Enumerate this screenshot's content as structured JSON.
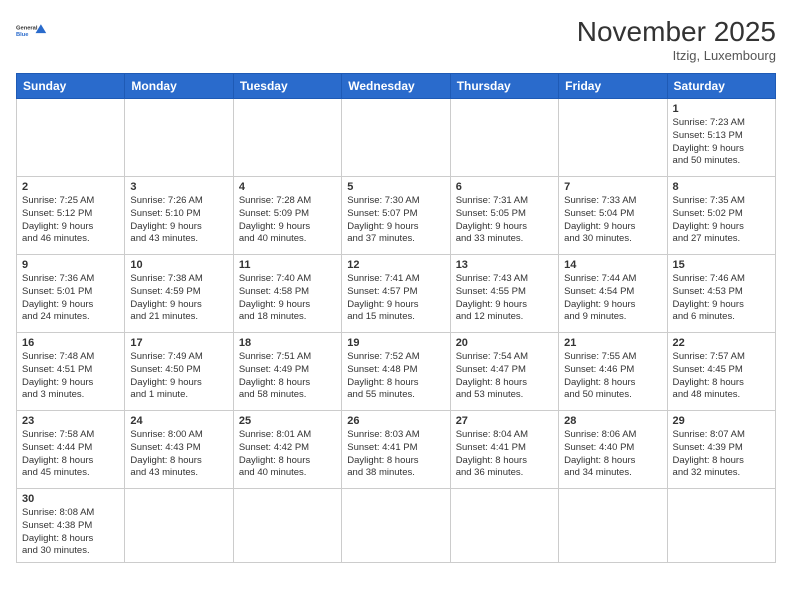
{
  "header": {
    "logo_general": "General",
    "logo_blue": "Blue",
    "month_title": "November 2025",
    "location": "Itzig, Luxembourg"
  },
  "weekdays": [
    "Sunday",
    "Monday",
    "Tuesday",
    "Wednesday",
    "Thursday",
    "Friday",
    "Saturday"
  ],
  "weeks": [
    [
      {
        "day": "",
        "info": ""
      },
      {
        "day": "",
        "info": ""
      },
      {
        "day": "",
        "info": ""
      },
      {
        "day": "",
        "info": ""
      },
      {
        "day": "",
        "info": ""
      },
      {
        "day": "",
        "info": ""
      },
      {
        "day": "1",
        "info": "Sunrise: 7:23 AM\nSunset: 5:13 PM\nDaylight: 9 hours\nand 50 minutes."
      }
    ],
    [
      {
        "day": "2",
        "info": "Sunrise: 7:25 AM\nSunset: 5:12 PM\nDaylight: 9 hours\nand 46 minutes."
      },
      {
        "day": "3",
        "info": "Sunrise: 7:26 AM\nSunset: 5:10 PM\nDaylight: 9 hours\nand 43 minutes."
      },
      {
        "day": "4",
        "info": "Sunrise: 7:28 AM\nSunset: 5:09 PM\nDaylight: 9 hours\nand 40 minutes."
      },
      {
        "day": "5",
        "info": "Sunrise: 7:30 AM\nSunset: 5:07 PM\nDaylight: 9 hours\nand 37 minutes."
      },
      {
        "day": "6",
        "info": "Sunrise: 7:31 AM\nSunset: 5:05 PM\nDaylight: 9 hours\nand 33 minutes."
      },
      {
        "day": "7",
        "info": "Sunrise: 7:33 AM\nSunset: 5:04 PM\nDaylight: 9 hours\nand 30 minutes."
      },
      {
        "day": "8",
        "info": "Sunrise: 7:35 AM\nSunset: 5:02 PM\nDaylight: 9 hours\nand 27 minutes."
      }
    ],
    [
      {
        "day": "9",
        "info": "Sunrise: 7:36 AM\nSunset: 5:01 PM\nDaylight: 9 hours\nand 24 minutes."
      },
      {
        "day": "10",
        "info": "Sunrise: 7:38 AM\nSunset: 4:59 PM\nDaylight: 9 hours\nand 21 minutes."
      },
      {
        "day": "11",
        "info": "Sunrise: 7:40 AM\nSunset: 4:58 PM\nDaylight: 9 hours\nand 18 minutes."
      },
      {
        "day": "12",
        "info": "Sunrise: 7:41 AM\nSunset: 4:57 PM\nDaylight: 9 hours\nand 15 minutes."
      },
      {
        "day": "13",
        "info": "Sunrise: 7:43 AM\nSunset: 4:55 PM\nDaylight: 9 hours\nand 12 minutes."
      },
      {
        "day": "14",
        "info": "Sunrise: 7:44 AM\nSunset: 4:54 PM\nDaylight: 9 hours\nand 9 minutes."
      },
      {
        "day": "15",
        "info": "Sunrise: 7:46 AM\nSunset: 4:53 PM\nDaylight: 9 hours\nand 6 minutes."
      }
    ],
    [
      {
        "day": "16",
        "info": "Sunrise: 7:48 AM\nSunset: 4:51 PM\nDaylight: 9 hours\nand 3 minutes."
      },
      {
        "day": "17",
        "info": "Sunrise: 7:49 AM\nSunset: 4:50 PM\nDaylight: 9 hours\nand 1 minute."
      },
      {
        "day": "18",
        "info": "Sunrise: 7:51 AM\nSunset: 4:49 PM\nDaylight: 8 hours\nand 58 minutes."
      },
      {
        "day": "19",
        "info": "Sunrise: 7:52 AM\nSunset: 4:48 PM\nDaylight: 8 hours\nand 55 minutes."
      },
      {
        "day": "20",
        "info": "Sunrise: 7:54 AM\nSunset: 4:47 PM\nDaylight: 8 hours\nand 53 minutes."
      },
      {
        "day": "21",
        "info": "Sunrise: 7:55 AM\nSunset: 4:46 PM\nDaylight: 8 hours\nand 50 minutes."
      },
      {
        "day": "22",
        "info": "Sunrise: 7:57 AM\nSunset: 4:45 PM\nDaylight: 8 hours\nand 48 minutes."
      }
    ],
    [
      {
        "day": "23",
        "info": "Sunrise: 7:58 AM\nSunset: 4:44 PM\nDaylight: 8 hours\nand 45 minutes."
      },
      {
        "day": "24",
        "info": "Sunrise: 8:00 AM\nSunset: 4:43 PM\nDaylight: 8 hours\nand 43 minutes."
      },
      {
        "day": "25",
        "info": "Sunrise: 8:01 AM\nSunset: 4:42 PM\nDaylight: 8 hours\nand 40 minutes."
      },
      {
        "day": "26",
        "info": "Sunrise: 8:03 AM\nSunset: 4:41 PM\nDaylight: 8 hours\nand 38 minutes."
      },
      {
        "day": "27",
        "info": "Sunrise: 8:04 AM\nSunset: 4:41 PM\nDaylight: 8 hours\nand 36 minutes."
      },
      {
        "day": "28",
        "info": "Sunrise: 8:06 AM\nSunset: 4:40 PM\nDaylight: 8 hours\nand 34 minutes."
      },
      {
        "day": "29",
        "info": "Sunrise: 8:07 AM\nSunset: 4:39 PM\nDaylight: 8 hours\nand 32 minutes."
      }
    ],
    [
      {
        "day": "30",
        "info": "Sunrise: 8:08 AM\nSunset: 4:38 PM\nDaylight: 8 hours\nand 30 minutes."
      },
      {
        "day": "",
        "info": ""
      },
      {
        "day": "",
        "info": ""
      },
      {
        "day": "",
        "info": ""
      },
      {
        "day": "",
        "info": ""
      },
      {
        "day": "",
        "info": ""
      },
      {
        "day": "",
        "info": ""
      }
    ]
  ]
}
